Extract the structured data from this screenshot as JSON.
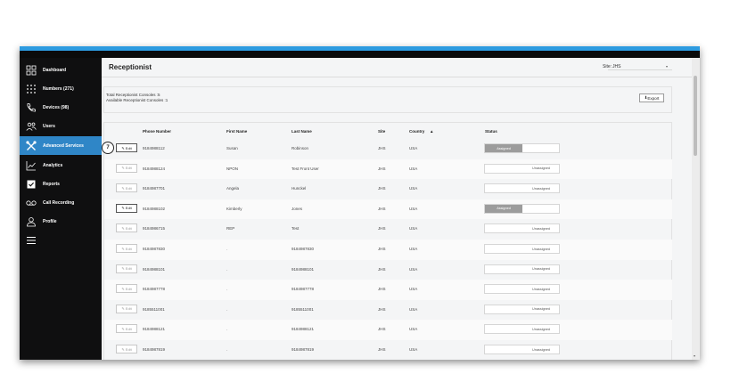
{
  "nav": [
    {
      "label": "Dashboard",
      "icon": "dashboard-icon",
      "active": false
    },
    {
      "label": "Numbers (271)",
      "icon": "dialpad-icon",
      "active": false
    },
    {
      "label": "Devices (98)",
      "icon": "phone-icon",
      "active": false
    },
    {
      "label": "Users",
      "icon": "users-icon",
      "active": false
    },
    {
      "label": "Advanced Services",
      "icon": "tools-icon",
      "active": true
    },
    {
      "label": "Analytics",
      "icon": "chart-icon",
      "active": false
    },
    {
      "label": "Reports",
      "icon": "checklist-icon",
      "active": false
    },
    {
      "label": "Call Recording",
      "icon": "voicemail-icon",
      "active": false
    },
    {
      "label": "Profile",
      "icon": "person-icon",
      "active": false
    },
    {
      "label": "",
      "icon": "menu-icon",
      "active": false
    }
  ],
  "header": {
    "title": "Receptionist",
    "site_label": "Site:",
    "site_value": "JHS"
  },
  "summary": {
    "line1": "Total Receptionist Consoles  :5",
    "line2": "Available Receptionist Consoles  :1",
    "export_label": "Export"
  },
  "table": {
    "headers": {
      "phone": "Phone Number",
      "first": "First Name",
      "last": "Last Name",
      "site": "Site",
      "country": "Country",
      "status": "Status"
    },
    "edit_label": "Edit",
    "rows": [
      {
        "phone": "9184988112",
        "first": "Susan",
        "last": "Robinson",
        "site": "JHS",
        "country": "USA",
        "status": "Assigned"
      },
      {
        "phone": "9184988124",
        "first": "NPON",
        "last": "Test Front User",
        "site": "JHS",
        "country": "USA",
        "status": "Unassigned"
      },
      {
        "phone": "9184987701",
        "first": "Angela",
        "last": "Hunckel",
        "site": "JHS",
        "country": "USA",
        "status": "Unassigned"
      },
      {
        "phone": "9184988102",
        "first": "Kimberly",
        "last": "Jones",
        "site": "JHS",
        "country": "USA",
        "status": "Assigned"
      },
      {
        "phone": "9184986715",
        "first": "REP",
        "last": "Test",
        "site": "JHS",
        "country": "USA",
        "status": "Unassigned"
      },
      {
        "phone": "9184987830",
        "first": ".",
        "last": "9184987830",
        "site": "JHS",
        "country": "USA",
        "status": "Unassigned"
      },
      {
        "phone": "9184988101",
        "first": ".",
        "last": "9184988101",
        "site": "JHS",
        "country": "USA",
        "status": "Unassigned"
      },
      {
        "phone": "9184987778",
        "first": ".",
        "last": "9184987778",
        "site": "JHS",
        "country": "USA",
        "status": "Unassigned"
      },
      {
        "phone": "9185511001",
        "first": ".",
        "last": "9185511001",
        "site": "JHS",
        "country": "USA",
        "status": "Unassigned"
      },
      {
        "phone": "9184988121",
        "first": ".",
        "last": "9184988121",
        "site": "JHS",
        "country": "USA",
        "status": "Unassigned"
      },
      {
        "phone": "9184987819",
        "first": ".",
        "last": "9184987819",
        "site": "JHS",
        "country": "USA",
        "status": "Unassigned"
      }
    ]
  },
  "callout": "7",
  "colors": {
    "accent": "#2f86c7",
    "topbar": "#2d9be0",
    "sidebar": "#0f0f10",
    "assigned": "#9c9c9c"
  }
}
